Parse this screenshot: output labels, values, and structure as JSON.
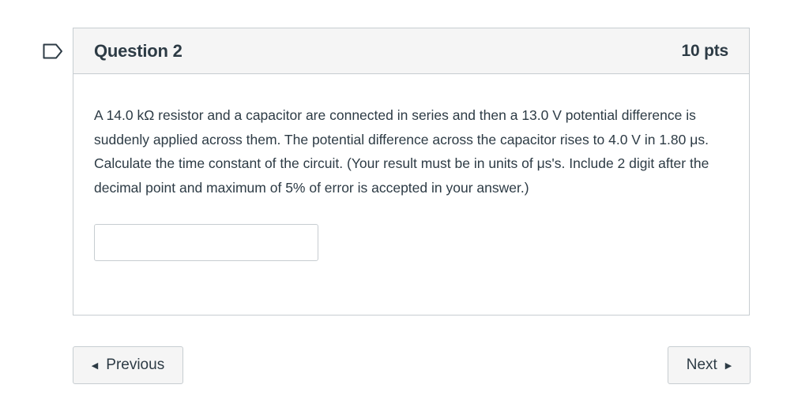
{
  "question": {
    "title": "Question 2",
    "points": "10 pts",
    "text": "A 14.0 kΩ resistor and a capacitor are connected in series and then a 13.0 V potential difference is suddenly applied across them. The potential difference across the capacitor rises to 4.0 V in  1.80 μs. Calculate the time constant of the circuit. (Your result must be in units of μs's. Include 2 digit after the decimal point and maximum of 5% of error is accepted in your answer.)",
    "answer_value": ""
  },
  "navigation": {
    "previous_label": "Previous",
    "next_label": "Next"
  },
  "icons": {
    "flag": "flag-question-icon",
    "previous": "caret-left-icon",
    "next": "caret-right-icon"
  },
  "colors": {
    "text": "#2d3b45",
    "border": "#c7cdd1",
    "header_bg": "#f5f5f5",
    "flag_outline": "#2d3b45"
  }
}
